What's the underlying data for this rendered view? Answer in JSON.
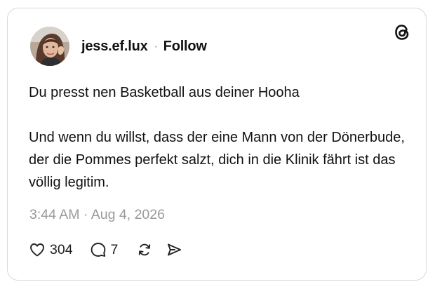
{
  "post": {
    "username": "jess.ef.lux",
    "separator": "·",
    "follow_label": "Follow",
    "paragraphs": [
      "Du presst nen Basketball aus deiner Hooha",
      "Und wenn du willst, dass der eine Mann von der Dönerbude, der die Pommes perfekt salzt, dich in die Klinik fährt ist das völlig legitim."
    ],
    "timestamp": "3:44 AM · Aug 4, 2026"
  },
  "actions": {
    "likes": "304",
    "replies": "7"
  },
  "icons": {
    "brand": "threads-logo-icon",
    "like": "heart-icon",
    "reply": "comment-icon",
    "repost": "repost-icon",
    "share": "send-icon"
  }
}
